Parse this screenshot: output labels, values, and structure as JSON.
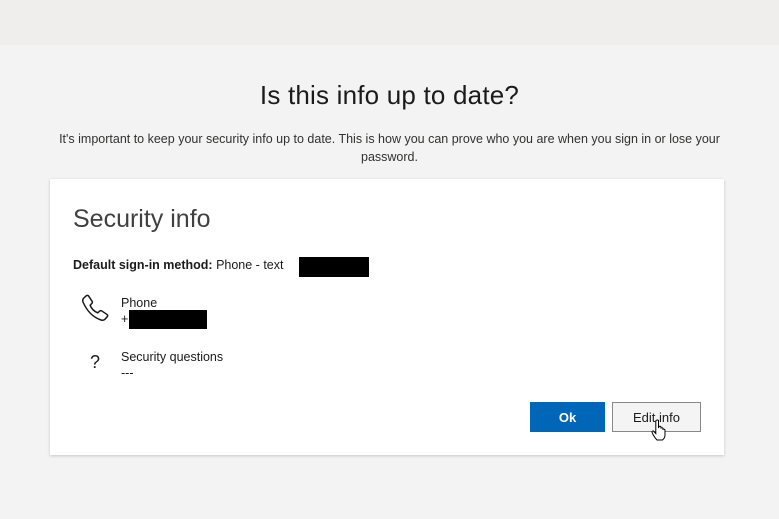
{
  "header": {
    "title": "Is this info up to date?",
    "description": "It's important to keep your security info up to date. This is how you can prove who you are when you sign in or lose your password."
  },
  "card": {
    "title": "Security info",
    "default_method_label": "Default sign-in method:",
    "default_method_value": "Phone - text",
    "methods": [
      {
        "name": "Phone",
        "detail": "+",
        "icon": "phone-icon"
      },
      {
        "name": "Security questions",
        "detail": "---",
        "icon": "question-mark-icon"
      }
    ]
  },
  "buttons": {
    "ok_label": "Ok",
    "edit_label": "Edit info"
  },
  "colors": {
    "primary": "#0067b8",
    "background": "#f3f3f3"
  }
}
